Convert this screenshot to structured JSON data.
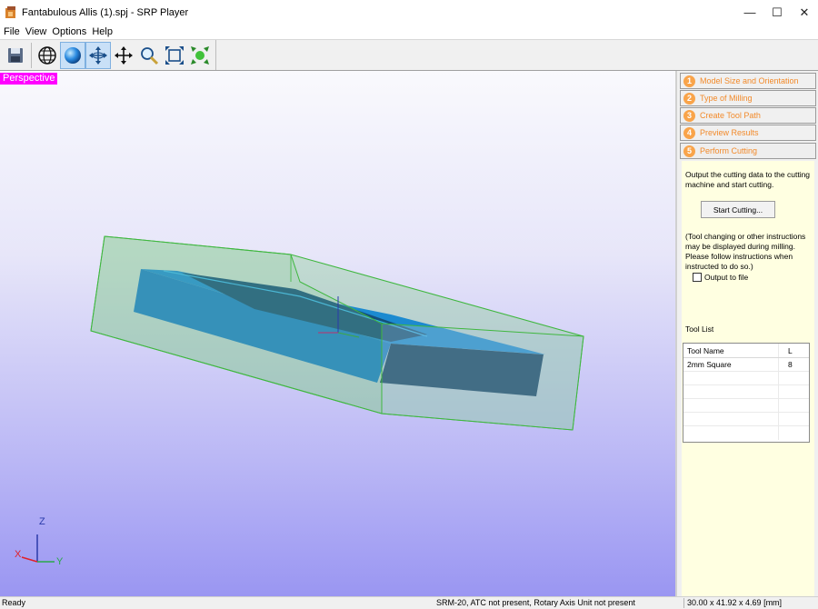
{
  "window": {
    "title": "Fantabulous Allis (1).spj - SRP Player",
    "minimize": "—",
    "maximize": "☐",
    "close": "✕"
  },
  "menu": [
    "File",
    "View",
    "Options",
    "Help"
  ],
  "toolbar": {
    "buttons": [
      "save-icon",
      "globe-icon",
      "sphere-icon",
      "rotate-icon",
      "move-icon",
      "zoom-icon",
      "fit-view-icon",
      "fit-selection-icon"
    ]
  },
  "viewport": {
    "label": "Perspective",
    "axes": {
      "z": "Z",
      "x": "X",
      "y": "Y"
    }
  },
  "steps": [
    {
      "num": "1",
      "label": "Model Size and Orientation"
    },
    {
      "num": "2",
      "label": "Type of Milling"
    },
    {
      "num": "3",
      "label": "Create Tool Path"
    },
    {
      "num": "4",
      "label": "Preview Results"
    },
    {
      "num": "5",
      "label": "Perform Cutting"
    }
  ],
  "panel": {
    "description": "Output the cutting data to the cutting machine and start cutting.",
    "start_button": "Start Cutting...",
    "note": "(Tool changing or other instructions may be displayed during milling. Please follow instructions when instructed to do so.)",
    "output_to_file": "Output to file",
    "tool_list_label": "Tool List",
    "tool_table": {
      "headers": [
        "Tool Name",
        "L"
      ],
      "rows": [
        [
          "2mm Square",
          "8"
        ]
      ]
    }
  },
  "status": {
    "left": "Ready",
    "middle": "SRM-20, ATC not present, Rotary Axis Unit not present",
    "right": "30.00 x  41.92 x   4.69 [mm]"
  },
  "colors": {
    "model": "#1a7ec4",
    "bounding_box": "#3fb73f",
    "perspective_label_bg": "#ff00ff",
    "step_accent": "#f28a2a",
    "panel_bg": "#ffffe1"
  }
}
